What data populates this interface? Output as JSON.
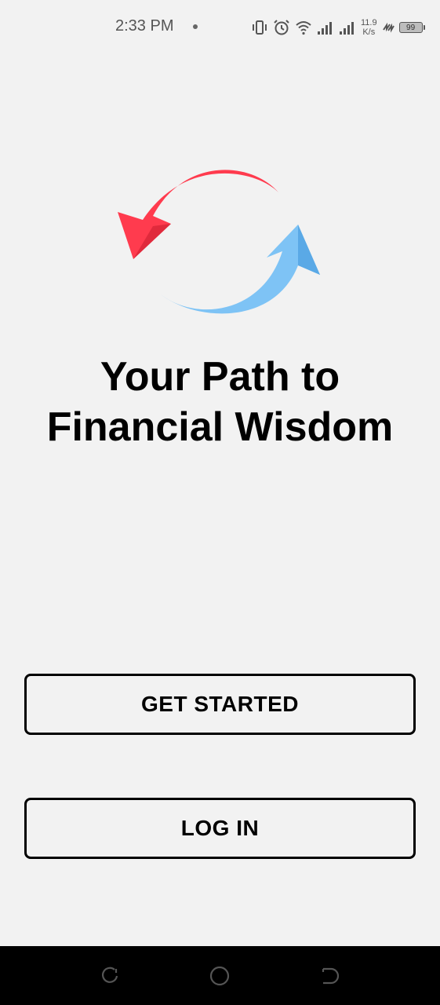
{
  "status_bar": {
    "time": "2:33 PM",
    "net_speed_value": "11.9",
    "net_speed_unit": "K/s",
    "battery_level": "99",
    "icons": [
      "vibrate-icon",
      "alarm-icon",
      "wifi-icon",
      "signal-icon",
      "signal-icon",
      "charging-icon",
      "battery-icon"
    ]
  },
  "logo": {
    "icon": "sync-arrows-icon",
    "colors": {
      "top_arrow": "#ff3b4e",
      "bottom_arrow": "#7ec3f5"
    }
  },
  "headline": {
    "line1": "Your Path to",
    "line2": "Financial Wisdom"
  },
  "actions": {
    "get_started_label": "GET STARTED",
    "login_label": "LOG IN"
  },
  "nav_bar": {
    "icons": [
      "recent-apps-icon",
      "home-icon",
      "back-icon"
    ]
  }
}
